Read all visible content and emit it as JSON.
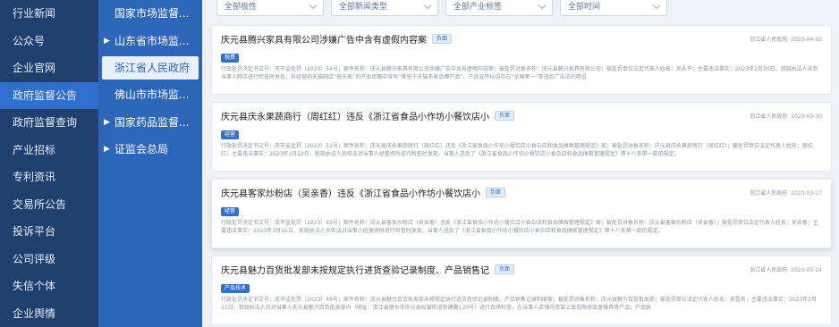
{
  "nav_primary": {
    "items": [
      {
        "label": "行业新闻",
        "active": false
      },
      {
        "label": "公众号",
        "active": false
      },
      {
        "label": "企业官网",
        "active": false
      },
      {
        "label": "政府监督公告",
        "active": true
      },
      {
        "label": "政府监督查询",
        "active": false
      },
      {
        "label": "产业招标",
        "active": false
      },
      {
        "label": "专利资讯",
        "active": false
      },
      {
        "label": "交易所公告",
        "active": false
      },
      {
        "label": "投诉平台",
        "active": false
      },
      {
        "label": "公司评级",
        "active": false
      },
      {
        "label": "失信个体",
        "active": false
      },
      {
        "label": "企业舆情",
        "active": false
      }
    ]
  },
  "nav_secondary": {
    "items": [
      {
        "label": "国家市场监督...",
        "caret": "",
        "active": false
      },
      {
        "label": "山东省市场监...",
        "caret": "▶",
        "active": false
      },
      {
        "label": "浙江省人民政府",
        "caret": "",
        "active": true
      },
      {
        "label": "佛山市市场监...",
        "caret": "",
        "active": false
      },
      {
        "label": "国家药品监督...",
        "caret": "▶",
        "active": false
      },
      {
        "label": "证监会总局",
        "caret": "▶",
        "active": false
      }
    ]
  },
  "filters": [
    {
      "label": "全部极性"
    },
    {
      "label": "全部新闻类型"
    },
    {
      "label": "全部产业标签"
    },
    {
      "label": "全部时间"
    }
  ],
  "cards": [
    {
      "title": "庆元县腾兴家具有限公司涉嫌广告中含有虚假内容案",
      "badge": "负面",
      "tag": "税费",
      "source": "浙江省人民政府",
      "date": "2023-04-03",
      "desc": "行政处罚决定书文号：庆市监处罚〔2023〕54号；案件名称：庆元县腾兴家具有限公司涉嫌广告中含有虚假内容案；被处罚对象名称：庆元县腾兴家具有限公司；被处罚单位法定代表人姓名：吴永平；主要违法事实：2023年2月20日，我局执法人员到当事人网店进行检查时发现，其经营的天猫网店“蓓乐家”的产品页面中含有“荣誉于天猫多家品牌产品”，产品宣传标语存在“全国第一”等违反广告法的用语"
    },
    {
      "title": "庆元县庆永果蔬商行（周红红）违反《浙江省食品小作坊小餐饮店小",
      "badge": "负面",
      "tag": "经营",
      "source": "浙江省人民政府",
      "date": "2023-03-30",
      "desc": "行政处罚决定书文号：庆市监处罚〔2023〕51号；案件名称：庆元县庆永果蔬商行（周红红）违反《浙江省食品小作坊小餐饮店小食杂店和食品摊贩管理规定》案；被处罚对象名称：庆元县庆永果蔬商行（周红红）；被处罚单位法定代表人姓名：周红红；主要违法事实：2023年3月22日，我局执法人员依法对当事人经营场所进行检查时发现，当事人违反了《浙江省食品小作坊小餐饮店小食杂店和食品摊贩管理规定》第十八条第一款的规定。"
    },
    {
      "title": "庆元县客家炒粉店（吴亲香）违反《浙江省食品小作坊小餐饮店小",
      "badge": "负面",
      "tag": "经营",
      "source": "浙江省人民政府",
      "date": "2023-03-27",
      "desc": "行政处罚决定书文号：庆市监处罚〔2023〕49号；案件名称：庆元县客家炒粉店（吴亲香）违反《浙江省食品小作坊小餐饮店小食杂店和食品摊贩管理规定》案；被处罚对象名称：庆元县客家炒粉店（吴亲香）；被处罚单位法定代表人姓名：吴亲香；主要违法事实：2023年3月15日，我局执法人员依法对当事人经营场所进行检查时发现，当事人违反了《浙江省食品小作坊小餐饮店小食杂店和食品摊贩管理规定》第十八条第一款的规定。"
    },
    {
      "title": "庆元县魅力百货批发部未按规定执行进货查验记录制度、产品销售记",
      "badge": "负面",
      "tag": "产品技术",
      "source": "浙江省人民政府",
      "date": "2023-03-24",
      "desc": "行政处罚决定书文号：庆市监处罚〔2023〕46号；案件名称：庆元县魅力百货批发部未按规定执行进货查验记录制度、产品销售记录制度案；被处罚对象名称：庆元县魅力百货批发部；被处罚单位法定代表人姓名：吴雪英；主要违法事实：2023年2月22日，我局执法人员对当事人庆元县魅力百货批发部内（地址：浙江省丽水市庆元县松源街道新建路130号）进行现场检查，在当事人店铺内货架上发现陶瓷饭盒餐具等产品；产品执"
    }
  ]
}
